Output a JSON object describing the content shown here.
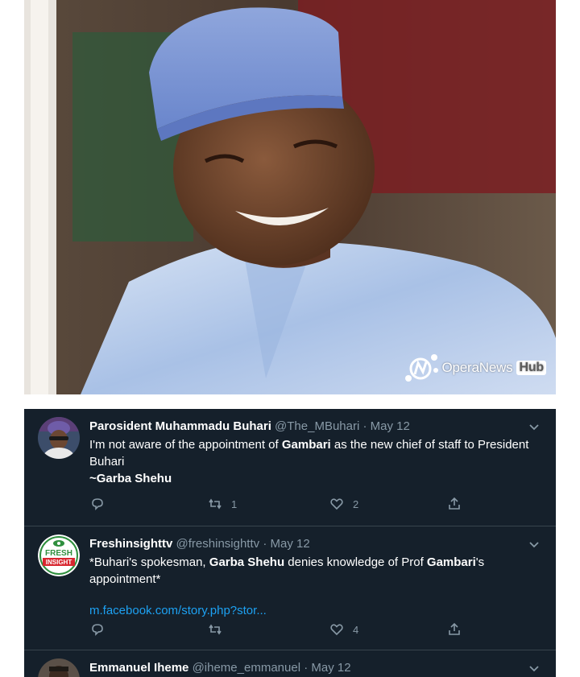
{
  "photo": {
    "watermark_brand": "OperaNews",
    "watermark_badge": "Hub"
  },
  "tweets": [
    {
      "name": "Parosident Muhammadu Buhari",
      "handle": "@The_MBuhari",
      "dot": "·",
      "date": "May 12",
      "text_parts": [
        "I'm not aware of the appointment of ",
        "Gambari",
        " as the new chief of staff to President Buhari"
      ],
      "signature": "~Garba Shehu",
      "reply_count": "",
      "retweet_count": "1",
      "like_count": "2"
    },
    {
      "name": "Freshinsighttv",
      "handle": "@freshinsighttv",
      "dot": "·",
      "date": "May 12",
      "text_parts": [
        "*Buhari's spokesman, ",
        "Garba Shehu",
        " denies knowledge of Prof ",
        "Gambari",
        "'s appointment*"
      ],
      "link": "m.facebook.com/story.php?stor...",
      "avatar_text_top": "FRESH",
      "avatar_text_bottom": "INSIGHT",
      "reply_count": "",
      "retweet_count": "",
      "like_count": "4"
    },
    {
      "name": "Emmanuel Iheme",
      "handle": "@iheme_emmanuel",
      "dot": "·",
      "date": "May 12"
    }
  ],
  "icons": {
    "reply": "reply-icon",
    "retweet": "retweet-icon",
    "like": "heart-icon",
    "share": "share-icon",
    "more": "chevron-down-icon"
  },
  "colors": {
    "feed_bg": "#15202b",
    "muted": "#8899a6",
    "link": "#1da1f2",
    "divider": "#38444d"
  }
}
